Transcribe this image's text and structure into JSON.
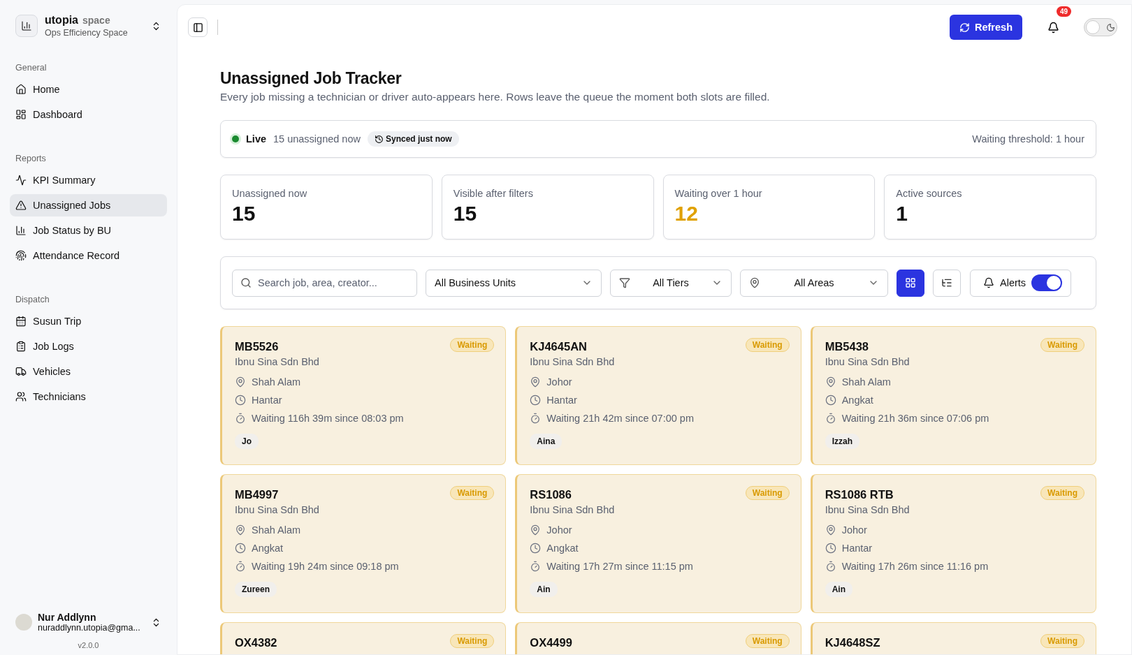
{
  "brand": {
    "name": "utopia",
    "suffix": "space",
    "subtitle": "Ops Efficiency Space"
  },
  "nav_sections": [
    {
      "heading": "General",
      "items": [
        {
          "label": "Home",
          "selected": false
        },
        {
          "label": "Dashboard",
          "selected": false
        }
      ]
    },
    {
      "heading": "Reports",
      "items": [
        {
          "label": "KPI Summary",
          "selected": false
        },
        {
          "label": "Unassigned Jobs",
          "selected": true
        },
        {
          "label": "Job Status by BU",
          "selected": false
        },
        {
          "label": "Attendance Record",
          "selected": false
        }
      ]
    },
    {
      "heading": "Dispatch",
      "items": [
        {
          "label": "Susun Trip",
          "selected": false
        },
        {
          "label": "Job Logs",
          "selected": false
        },
        {
          "label": "Vehicles",
          "selected": false
        },
        {
          "label": "Technicians",
          "selected": false
        }
      ]
    }
  ],
  "user": {
    "name": "Nur Addlynn",
    "email": "nuraddlynn.utopia@gma..."
  },
  "version": "v2.0.0",
  "header": {
    "refresh": "Refresh",
    "notifications": "49",
    "dark_mode": false
  },
  "page": {
    "title": "Unassigned Job Tracker",
    "subtitle": "Every job missing a technician or driver auto-appears here. Rows leave the queue the moment both slots are filled."
  },
  "status": {
    "live": "Live",
    "count": "15 unassigned now",
    "synced": "Synced just now",
    "threshold": "Waiting threshold: 1 hour"
  },
  "stats": [
    {
      "label": "Unassigned now",
      "value": "15",
      "alert": false
    },
    {
      "label": "Visible after filters",
      "value": "15",
      "alert": false
    },
    {
      "label": "Waiting over 1 hour",
      "value": "12",
      "alert": true
    },
    {
      "label": "Active sources",
      "value": "1",
      "alert": false
    }
  ],
  "filters": {
    "search_placeholder": "Search job, area, creator...",
    "business_unit": "All Business Units",
    "tier": "All Tiers",
    "area": "All Areas",
    "views": [
      {
        "selected": true
      },
      {
        "selected": false
      }
    ],
    "alerts": {
      "label": "Alerts",
      "on": true
    }
  },
  "jobs": [
    {
      "id": "MB5526",
      "status": "Waiting",
      "company": "Ibnu Sina Sdn Bhd",
      "area": "Shah Alam",
      "type": "Hantar",
      "waiting": "Waiting 116h 39m since 08:03 pm",
      "assignee": "Jo"
    },
    {
      "id": "KJ4645AN",
      "status": "Waiting",
      "company": "Ibnu Sina Sdn Bhd",
      "area": "Johor",
      "type": "Hantar",
      "waiting": "Waiting 21h 42m since 07:00 pm",
      "assignee": "Aina"
    },
    {
      "id": "MB5438",
      "status": "Waiting",
      "company": "Ibnu Sina Sdn Bhd",
      "area": "Shah Alam",
      "type": "Angkat",
      "waiting": "Waiting 21h 36m since 07:06 pm",
      "assignee": "Izzah"
    },
    {
      "id": "MB4997",
      "status": "Waiting",
      "company": "Ibnu Sina Sdn Bhd",
      "area": "Shah Alam",
      "type": "Angkat",
      "waiting": "Waiting 19h 24m since 09:18 pm",
      "assignee": "Zureen"
    },
    {
      "id": "RS1086",
      "status": "Waiting",
      "company": "Ibnu Sina Sdn Bhd",
      "area": "Johor",
      "type": "Angkat",
      "waiting": "Waiting 17h 27m since 11:15 pm",
      "assignee": "Ain"
    },
    {
      "id": "RS1086 RTB",
      "status": "Waiting",
      "company": "Ibnu Sina Sdn Bhd",
      "area": "Johor",
      "type": "Hantar",
      "waiting": "Waiting 17h 26m since 11:16 pm",
      "assignee": "Ain"
    },
    {
      "id": "OX4382",
      "status": "Waiting"
    },
    {
      "id": "OX4499",
      "status": "Waiting"
    },
    {
      "id": "KJ4648SZ",
      "status": "Waiting"
    }
  ]
}
